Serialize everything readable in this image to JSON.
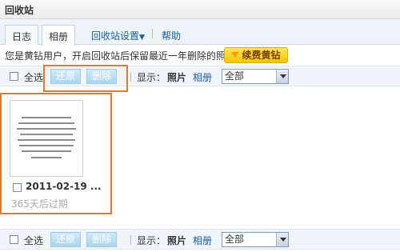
{
  "window": {
    "title": "回收站"
  },
  "tabs": [
    {
      "label": "日志"
    },
    {
      "label": "相册"
    },
    {
      "label": "回收站设置"
    },
    {
      "label": "帮助"
    }
  ],
  "info": {
    "message": "您是黄钻用户，开启回收站后保留最近一年删除的照片",
    "renew_label": "续费黄钻"
  },
  "toolbar": {
    "select_all": "全选",
    "restore": "还原",
    "delete": "删除",
    "display_label": "显示：",
    "photo": "照片",
    "album": "相册",
    "filter_value": "全部"
  },
  "item": {
    "date": "2011-02-19 ...",
    "expiry": "365天后过期"
  },
  "colors": {
    "highlight": "#e07a2c",
    "button": "#a9d6ee",
    "link": "#1a5fa8",
    "renew": "#f6c500"
  }
}
